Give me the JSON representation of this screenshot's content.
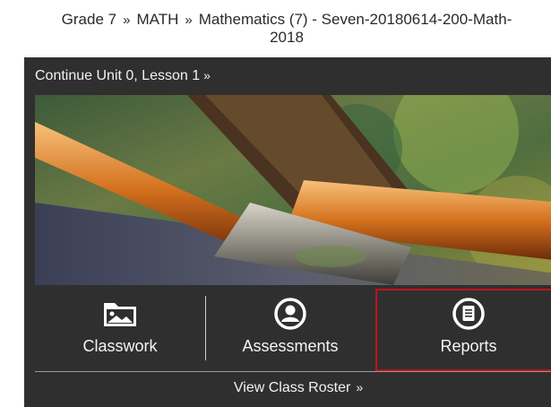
{
  "breadcrumb": {
    "items": [
      "Grade 7",
      "MATH",
      "Mathematics (7) - Seven-20180614-200-Math-",
      "2018"
    ],
    "separator": "»"
  },
  "card": {
    "continue_label": "Continue Unit 0, Lesson 1",
    "continue_chevron": "»",
    "hero_image": "paintbrushes",
    "actions": [
      {
        "label": "Classwork",
        "icon": "image-folder-icon"
      },
      {
        "label": "Assessments",
        "icon": "user-circle-icon"
      },
      {
        "label": "Reports",
        "icon": "document-circle-icon"
      }
    ],
    "roster_label": "View Class Roster",
    "roster_chevron": "»"
  },
  "colors": {
    "card_bg": "#2f2f2f",
    "highlight": "#c0121b",
    "text_light": "#f4f4f4"
  }
}
